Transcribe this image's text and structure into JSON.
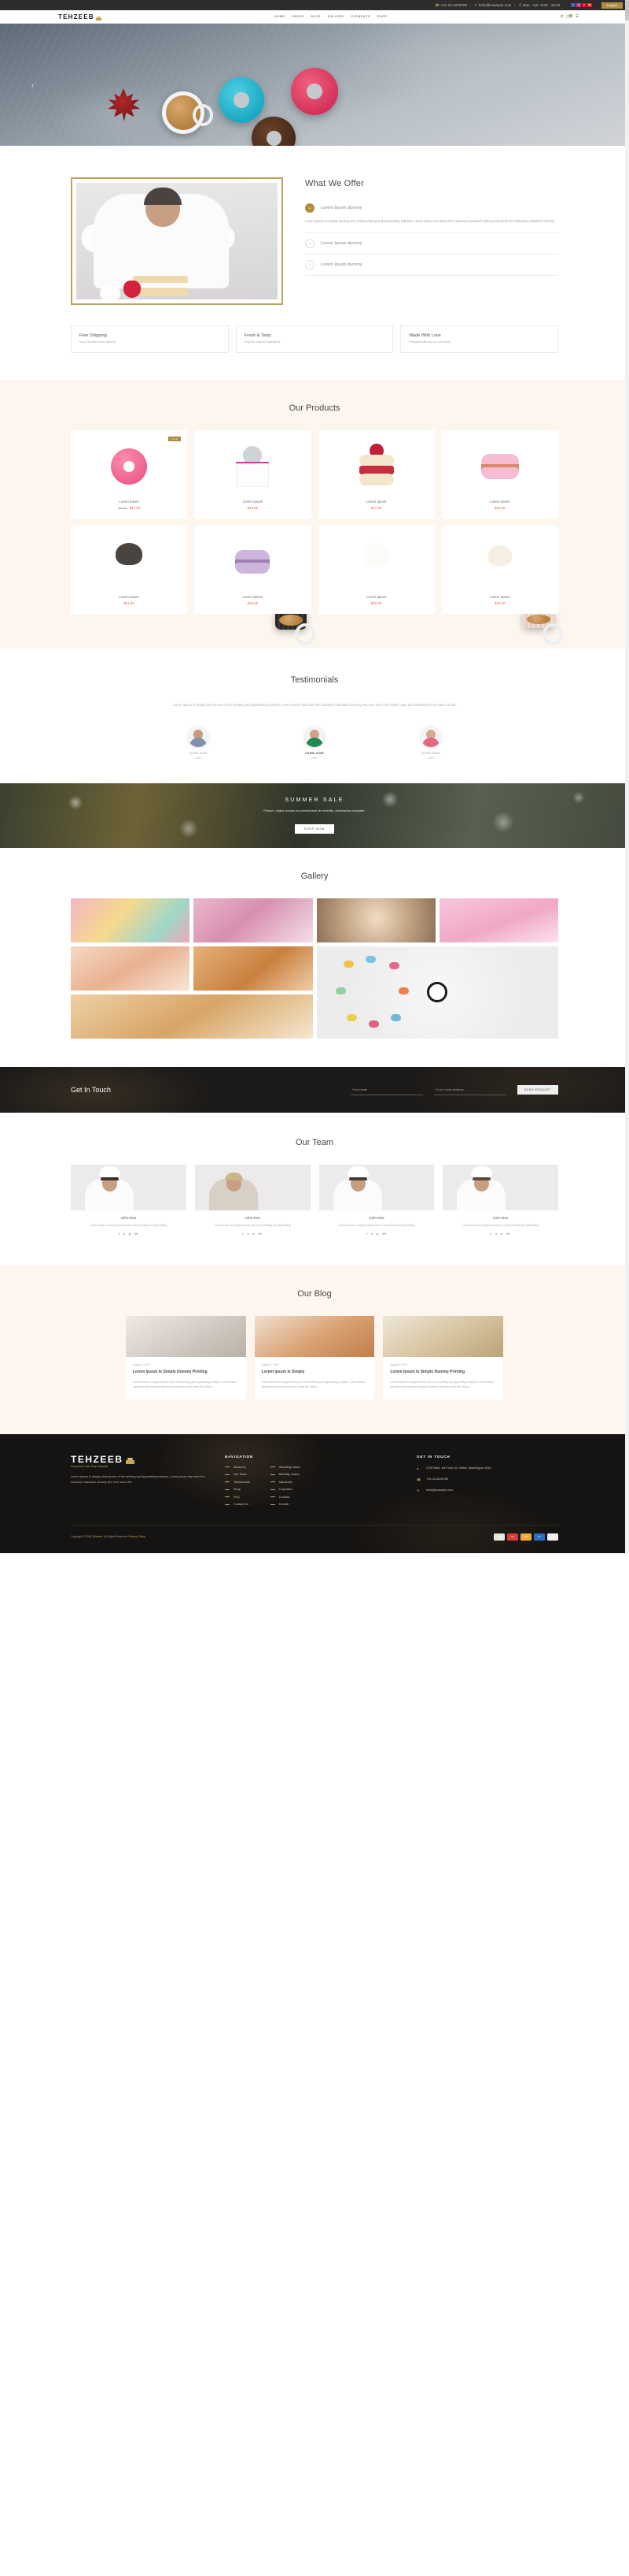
{
  "topbar": {
    "phone": "+01-23-4226789",
    "email": "hello@example.com",
    "hours": "Mon - Sat: 9:00 - 18:00",
    "phone_icon": "phone-icon",
    "email_icon": "envelope-icon",
    "clock_icon": "clock-icon",
    "socials": [
      {
        "name": "facebook-icon",
        "glyph": "f",
        "color": "#3b5998"
      },
      {
        "name": "instagram-icon",
        "glyph": "◎",
        "color": "#b5338a"
      },
      {
        "name": "pinterest-icon",
        "glyph": "p",
        "color": "#e60023"
      },
      {
        "name": "youtube-icon",
        "glyph": "▶",
        "color": "#e62117"
      }
    ],
    "language_button": "English"
  },
  "header": {
    "logo": "TEHZEEB",
    "nav": [
      "HOME",
      "PAGES",
      "BLOG",
      "GALLERY",
      "ELEMENTS",
      "SHOP"
    ],
    "search_icon": "search-icon",
    "cart_icon": "cart-icon",
    "cart_count": "0",
    "menu_icon": "hamburger-menu-icon"
  },
  "hero": {
    "prev_arrow": "‹"
  },
  "offer": {
    "title": "What We Offer",
    "accordion": [
      {
        "label": "Lorem Ipsum dummy",
        "open": true,
        "body": "Lorem Ipsum is simply dummy text of the printing and typesetting industry. Lorem Ipsum has been the industry's standach dummy has been the industry's standach dummy"
      },
      {
        "label": "Lorem Ipsum dummy",
        "open": false,
        "body": ""
      },
      {
        "label": "Lorem Ipsum dummy",
        "open": false,
        "body": ""
      }
    ],
    "features": [
      {
        "title": "Free Shipping",
        "sub": "Enjoy our fast & free delivery"
      },
      {
        "title": "Fresh & Tasty",
        "sub": "Only the freshest ingredients"
      },
      {
        "title": "Made With Love",
        "sub": "Prepared with care for our clients"
      }
    ]
  },
  "products": {
    "title": "Our Products",
    "sale_label": "SALE",
    "items": [
      {
        "name": "Lorem Ipsum",
        "price": "$17.00",
        "old_price": "$39.00",
        "sale": true,
        "shape": "donut-pink"
      },
      {
        "name": "Lorem Ipsum",
        "price": "$13.00",
        "old_price": "",
        "sale": false,
        "shape": "drip-cake"
      },
      {
        "name": "Lorem Ipsum",
        "price": "$17.00",
        "old_price": "",
        "sale": false,
        "shape": "strawberry-shortcake"
      },
      {
        "name": "Lorem Ipsum",
        "price": "$14.00",
        "old_price": "",
        "sale": false,
        "shape": "macaron-pink"
      },
      {
        "name": "Lorem Ipsum",
        "price": "$11.00",
        "old_price": "",
        "sale": false,
        "shape": "dark-cupcake"
      },
      {
        "name": "Lorem Ipsum",
        "price": "$15.00",
        "old_price": "",
        "sale": false,
        "shape": "macaron-purple"
      },
      {
        "name": "Lorem Ipsum",
        "price": "$22.00",
        "old_price": "",
        "sale": false,
        "shape": "sprinkle-cupcake"
      },
      {
        "name": "Lorem Ipsum",
        "price": "$10.00",
        "old_price": "",
        "sale": false,
        "shape": "plain-cupcake"
      }
    ]
  },
  "testimonials": {
    "title": "Testimonials",
    "intro": "Lorem Ipsum is simply dummy text of the printing and typesetting industry. Lorem Ipsum has been the industry's standach dummy text ever since the 1500s, type and scrambled it to make a book.",
    "people": [
      {
        "name": "JOHN DOE",
        "role": "Client",
        "active": false
      },
      {
        "name": "JOHN DOE",
        "role": "Client",
        "active": true
      },
      {
        "name": "JOHN DOE",
        "role": "Client",
        "active": false
      }
    ]
  },
  "sale_banner": {
    "title": "SUMMER SALE",
    "subtitle": "Flavum, regius rumors vix prensionem de emeritis, camerarius compater.",
    "button": "SHOP NOW"
  },
  "gallery": {
    "title": "Gallery",
    "tiles": [
      "macarons",
      "pink-flowers",
      "coffee-cup",
      "cupcake",
      "cake-slices",
      "fruit-tart",
      "macaron-circle",
      "pancakes"
    ]
  },
  "contact": {
    "heading": "Get In Touch",
    "name_placeholder": "Your name",
    "email_placeholder": "Your e-mail address",
    "button": "SEND REQUEST"
  },
  "team": {
    "title": "Our Team",
    "members": [
      {
        "name": "John Doe",
        "desc": "Lorem Ipsum is simply dummy text of the printing and typesetting"
      },
      {
        "name": "John Doe",
        "desc": "Lorem Ipsum is simply dummy text of the printing and typesetting"
      },
      {
        "name": "John Doe",
        "desc": "Lorem Ipsum is simply dummy text of the printing and typesetting"
      },
      {
        "name": "John Doe",
        "desc": "Lorem Ipsum is simply dummy text of the printing and typesetting"
      }
    ],
    "social_icons": [
      "facebook-icon",
      "twitter-icon",
      "pinterest-icon",
      "google-plus-icon"
    ]
  },
  "blog": {
    "title": "Our Blog",
    "posts": [
      {
        "date": "August 9, 2018",
        "title": "Lorem Ipsum Is Simply Dummy Printing",
        "excerpt": "Lorem Ipsum is simply dummy text of the printing and typesetting industry. Lorem Ipsum has been the industry's standach dummy text ever since the 1500s..."
      },
      {
        "date": "August 9, 2018",
        "title": "Lorem Ipsum Is Simply",
        "excerpt": "Lorem Ipsum is simply dummy text of the printing and typesetting industry. Lorem Ipsum has been the dummy text ever since the 1500s..."
      },
      {
        "date": "August 9, 2018",
        "title": "Lorem Ipsum Is Simply Dummy Printing",
        "excerpt": "Lorem Ipsum is simply dummy text of the printing and typesetting industry. Lorem Ipsum has been the industry's standach dummy text ever since the 1500s..."
      }
    ]
  },
  "footer": {
    "logo": "TEHZEEB",
    "tagline": "Responsive Cake Shop Template",
    "about": "Lorem Ipsum is simply dummy text of the printing and typesetting industry. Lorem Ipsum has been the industry's standach dummy text ever since the",
    "nav_heading": "NAVIGATION",
    "nav_col1": [
      "About Us",
      "Our Team",
      "Testimonials",
      "Shop",
      "FAQ",
      "Contact Us"
    ],
    "nav_col2": [
      "Wedding Cakes",
      "Birthday Cakes",
      "Macarons",
      "Cupcakes",
      "Cookies",
      "Donuts"
    ],
    "contact_heading": "GET IN TOUCH",
    "address": "2728 St#4, 1st Floor DC Office, Washington USA",
    "phone": "+01-23-4226789",
    "email": "hello@example.com",
    "location_icon": "location-pin-icon",
    "phone_icon": "phone-icon",
    "email_icon": "envelope-icon",
    "copyright_pre": "Copyright © 2018 ",
    "copyright_brand": "Tehzeeb",
    "copyright_post": ". All Rights Reserved. ",
    "privacy_link": "Privacy Policy",
    "payments": [
      "visa",
      "mastercard",
      "discover",
      "amex",
      "paypal"
    ]
  },
  "colors": {
    "gold": "#b08d3f",
    "cream": "#fdf6ef",
    "dark": "#1d1b19",
    "price_red": "#ef5b4c"
  }
}
